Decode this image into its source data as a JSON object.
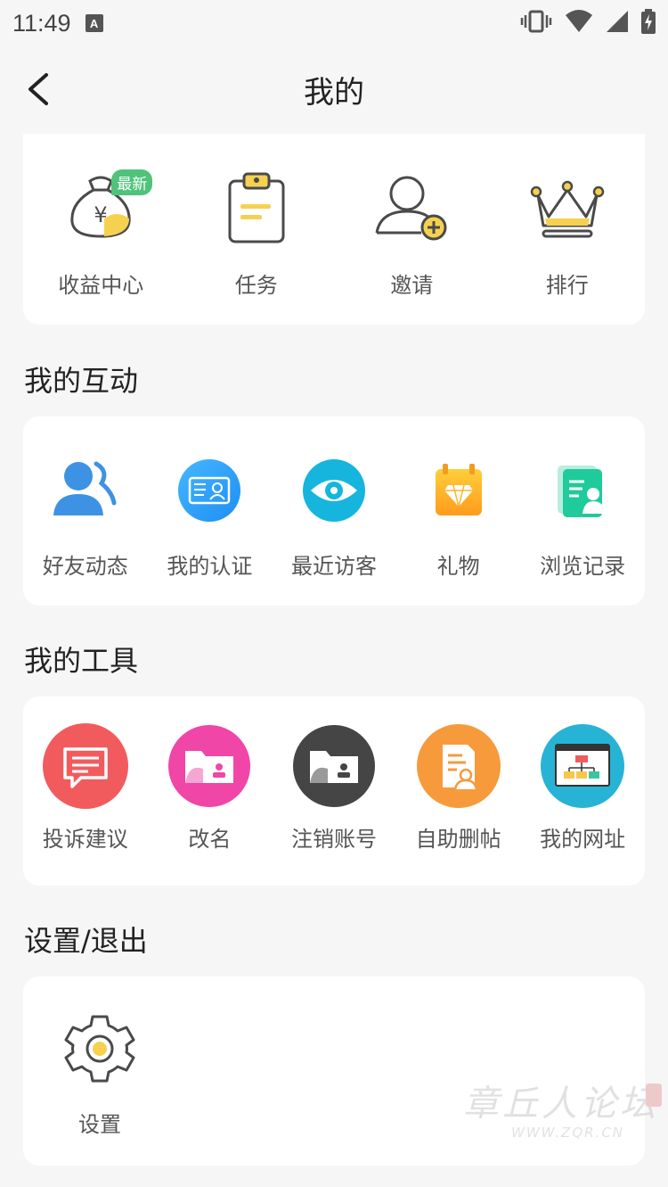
{
  "status": {
    "time": "11:49",
    "notif": "A"
  },
  "nav": {
    "title": "我的"
  },
  "top_items": [
    {
      "label": "收益中心",
      "badge": "最新",
      "icon": "money-bag-icon"
    },
    {
      "label": "任务",
      "icon": "clipboard-icon"
    },
    {
      "label": "邀请",
      "icon": "invite-user-icon"
    },
    {
      "label": "排行",
      "icon": "crown-icon"
    }
  ],
  "sections": {
    "interaction": {
      "title": "我的互动",
      "items": [
        {
          "label": "好友动态",
          "icon": "friends-icon"
        },
        {
          "label": "我的认证",
          "icon": "id-card-icon"
        },
        {
          "label": "最近访客",
          "icon": "eye-icon"
        },
        {
          "label": "礼物",
          "icon": "gift-diamond-icon"
        },
        {
          "label": "浏览记录",
          "icon": "history-record-icon"
        }
      ]
    },
    "tools": {
      "title": "我的工具",
      "items": [
        {
          "label": "投诉建议",
          "icon": "feedback-icon",
          "color": "#f25b5e"
        },
        {
          "label": "改名",
          "icon": "rename-folder-icon",
          "color": "#f046a8"
        },
        {
          "label": "注销账号",
          "icon": "close-account-icon",
          "color": "#454545"
        },
        {
          "label": "自助删帖",
          "icon": "delete-post-icon",
          "color": "#f79a3c"
        },
        {
          "label": "我的网址",
          "icon": "website-icon",
          "color": "#27b3d6"
        }
      ]
    },
    "settings": {
      "title": "设置/退出",
      "items": [
        {
          "label": "设置",
          "icon": "gear-icon"
        }
      ]
    }
  },
  "watermark": {
    "text": "章丘人论坛",
    "url": "WWW.ZQR.CN"
  }
}
